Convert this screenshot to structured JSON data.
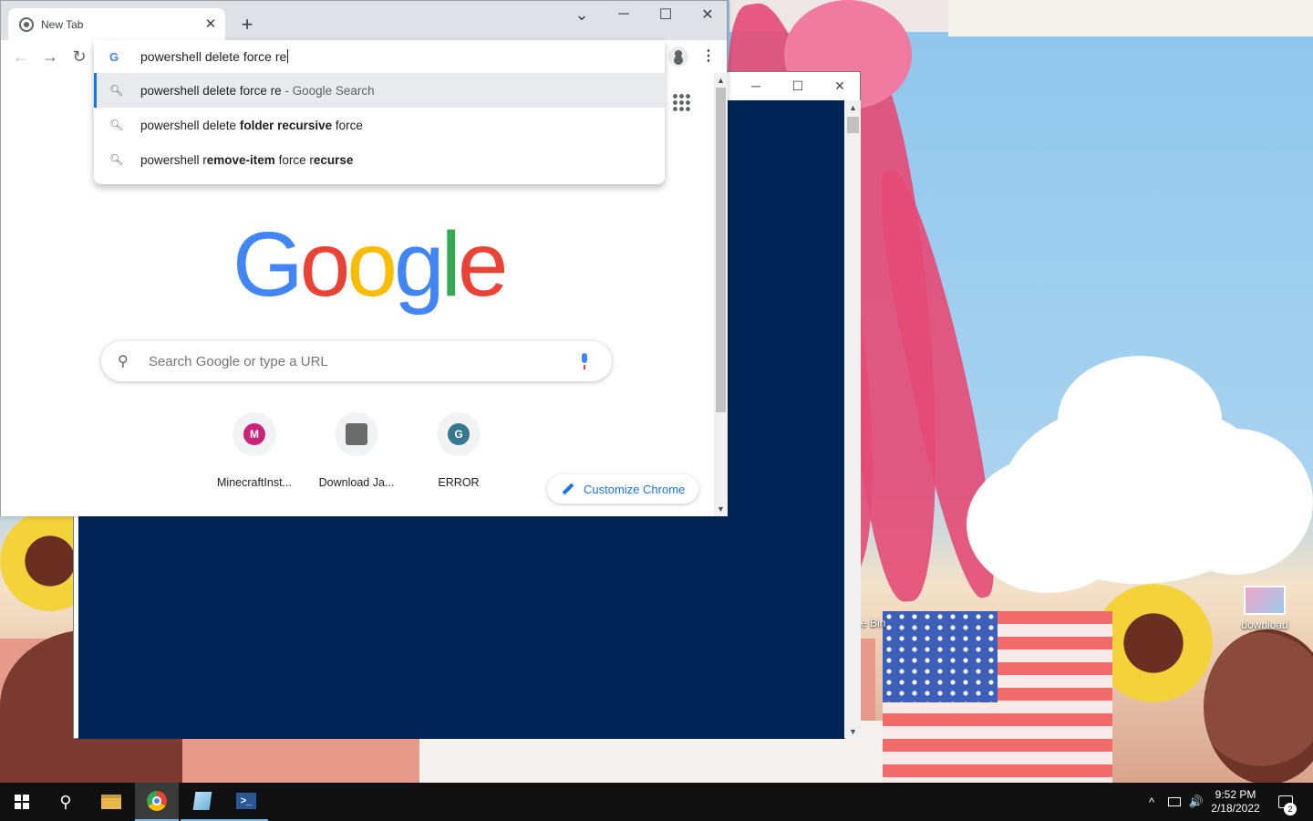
{
  "chrome": {
    "tab_title": "New Tab",
    "tab_close": "✕",
    "new_tab": "+",
    "tab_search": "⌄",
    "minimize": "─",
    "maximize": "☐",
    "close": "✕",
    "back": "←",
    "forward": "→",
    "reload": "↻",
    "omnibox_text": "powershell delete force re",
    "omnibox_icon": "G",
    "menu": "⋮",
    "suggestions": [
      {
        "parts": [
          "powershell delete force re"
        ],
        "hint": " - Google Search"
      },
      {
        "parts": [
          "powershell delete ",
          "folder recursive",
          " force"
        ]
      },
      {
        "parts": [
          "powershell r",
          "emove-item",
          " force r",
          "ecurse"
        ]
      }
    ]
  },
  "ntp": {
    "logo": [
      "G",
      "o",
      "o",
      "g",
      "l",
      "e"
    ],
    "search_placeholder": "Search Google or type a URL",
    "search_icon": "🔍",
    "shortcuts": [
      {
        "label": "MinecraftInst...",
        "initial": "M",
        "color": "#c9237a"
      },
      {
        "label": "Download Ja...",
        "initial": "",
        "color": "#6b6b6b"
      },
      {
        "label": "ERROR",
        "initial": "G",
        "color": "#37788e"
      }
    ],
    "customize_label": "Customize Chrome"
  },
  "powershell": {
    "minimize": "─",
    "maximize": "☐",
    "close": "✕"
  },
  "desktop": {
    "icon_label": "download",
    "bin_label": "e Bin"
  },
  "taskbar": {
    "time": "9:52 PM",
    "date": "2/18/2022",
    "notification_count": "2",
    "tray_chevron": "^",
    "volume": "🔊"
  }
}
